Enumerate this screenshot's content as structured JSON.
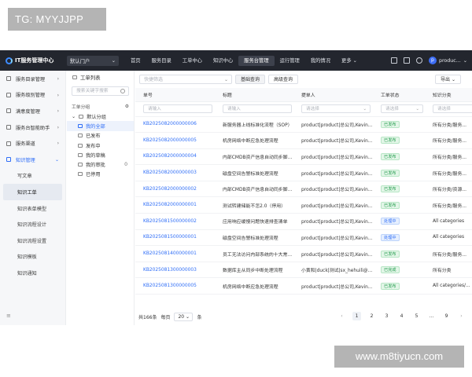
{
  "watermarks": {
    "top_left": "TG: MYYJJPP",
    "bottom_right": "www.m8tiyucn.com"
  },
  "topnav": {
    "brand": "IT服务管理中心",
    "portal": "默认门户",
    "items": [
      "首页",
      "服务目录",
      "工单中心",
      "知识中心",
      "服务台管理",
      "运行管理",
      "我的情况",
      "更多"
    ],
    "active_index": 4,
    "user": "produc..."
  },
  "sidebar": {
    "items": [
      {
        "label": "服务目录管理"
      },
      {
        "label": "服务级别管理"
      },
      {
        "label": "满意度管理"
      },
      {
        "label": "服务台智能助手"
      },
      {
        "label": "服务渠道"
      },
      {
        "label": "知识管理"
      }
    ],
    "subitems": [
      "写文章",
      "知识工单",
      "知识表单模型",
      "知识流程设计",
      "知识流程设置",
      "知识模板",
      "知识通知"
    ],
    "active_sub_index": 1,
    "collapse_icon": "≡"
  },
  "tree": {
    "title": "工单列表",
    "search_placeholder": "搜索关键字搜索",
    "header": "工单分组",
    "root": "默认分组",
    "nodes": [
      {
        "label": "我的全部",
        "count": ""
      },
      {
        "label": "已发布",
        "count": ""
      },
      {
        "label": "发布中",
        "count": ""
      },
      {
        "label": "我的草稿",
        "count": ""
      },
      {
        "label": "我的审批",
        "count": "0"
      },
      {
        "label": "已停用",
        "count": ""
      }
    ]
  },
  "toolbar": {
    "filter_placeholder": "快捷筛选",
    "quick_query": "基础查询",
    "advanced_query": "高级查询",
    "export": "导出"
  },
  "table": {
    "columns": [
      "单号",
      "标题",
      "提单人",
      "工单状态",
      "知识分类"
    ],
    "filters": [
      "请输入",
      "请输入",
      "请选择",
      "请选择",
      "请选择"
    ],
    "rows": [
      {
        "id": "KB2025082000000006",
        "title": "新服务器上线标准化流程（SOP）",
        "submitter": "product|product|总公司,Kevin...",
        "status": "已发布",
        "status_type": "pub",
        "category": "所有分类/服务..."
      },
      {
        "id": "KB2025082000000005",
        "title": "机房网络中断应急处理流程",
        "submitter": "product|product|总公司,Kevin...",
        "status": "已发布",
        "status_type": "pub",
        "category": "所有分类/服务..."
      },
      {
        "id": "KB2025082000000004",
        "title": "内部CMDB资产信息自动同步脚...",
        "submitter": "product|product|总公司,Kevin...",
        "status": "已发布",
        "status_type": "pub",
        "category": "所有分类/服务..."
      },
      {
        "id": "KB2025082000000003",
        "title": "磁盘空间告警标准处理流程",
        "submitter": "product|product|总公司,Kevin...",
        "status": "已发布",
        "status_type": "pub",
        "category": "所有分类/服务..."
      },
      {
        "id": "KB2025082000000002",
        "title": "内部CMDB资产信息自动同步脚...",
        "submitter": "product|product|总公司,Kevin...",
        "status": "已发布",
        "status_type": "pub",
        "category": "所有分类/资源..."
      },
      {
        "id": "KB2025082000000001",
        "title": "测试转建储能不怎2.0（停用）",
        "submitter": "product|product|总公司,Kevin...",
        "status": "已发布",
        "status_type": "pub",
        "category": "所有分类/服务..."
      },
      {
        "id": "KB2025081500000002",
        "title": "应用响应缓慢问题快速排查清单",
        "submitter": "product|product|总公司,Kevin...",
        "status": "处理中",
        "status_type": "proc",
        "category": "All categories"
      },
      {
        "id": "KB2025081500000001",
        "title": "磁盘空间告警标准处理流程",
        "submitter": "product|product|总公司,Kevin...",
        "status": "处理中",
        "status_type": "proc",
        "category": "All categories"
      },
      {
        "id": "KB2025081400000001",
        "title": "员工无法访问内部系统的十大常...",
        "submitter": "product|product|总公司,Kevin...",
        "status": "已发布",
        "status_type": "pub",
        "category": "所有分类/服务..."
      },
      {
        "id": "KB2025081300000003",
        "title": "数据库主从同步中断处理流程",
        "submitter": "小黄和|duck|测试|sx_hehuili@...",
        "status": "已完成",
        "status_type": "pub",
        "category": "所有分类"
      },
      {
        "id": "KB2025081300000005",
        "title": "机房网络中断应急处理流程",
        "submitter": "product|product|总公司,Kevin...",
        "status": "已发布",
        "status_type": "pub",
        "category": "All categories/..."
      }
    ]
  },
  "pager": {
    "total": "共166条",
    "per_page_label": "每页",
    "per_page": "20",
    "unit": "条",
    "pages": [
      "1",
      "2",
      "3",
      "4",
      "5",
      "...",
      "9"
    ],
    "current_index": 0
  }
}
